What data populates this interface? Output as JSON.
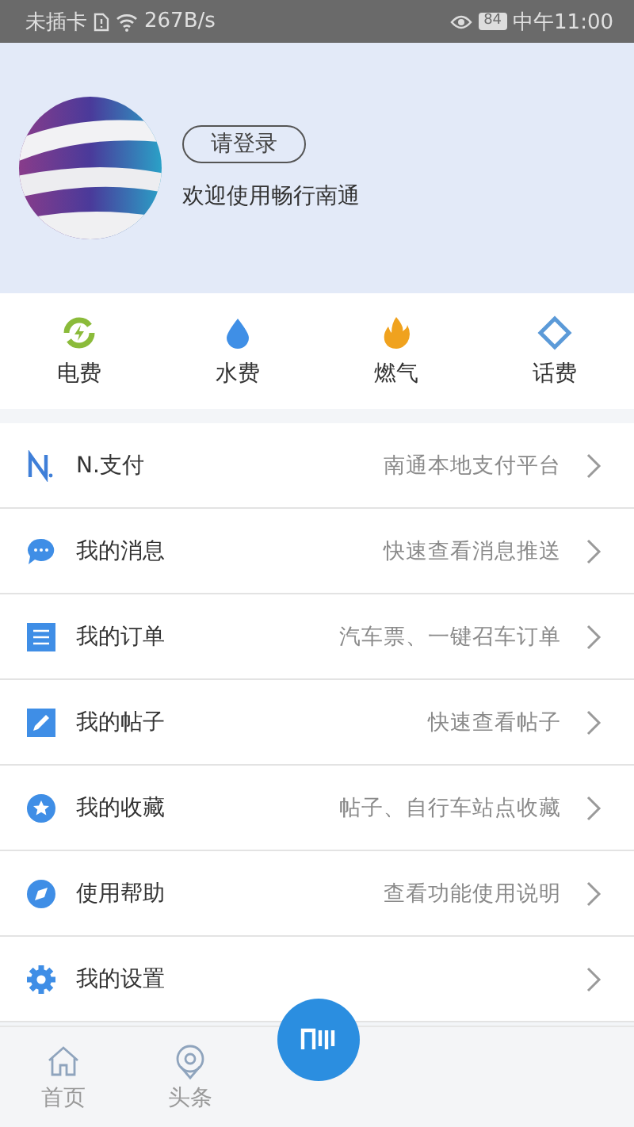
{
  "status_bar": {
    "carrier": "未插卡",
    "speed": "267B/s",
    "battery": "84",
    "time": "中午11:00"
  },
  "profile": {
    "login_button": "请登录",
    "welcome": "欢迎使用畅行南通"
  },
  "shortcuts": [
    {
      "kind": "power",
      "label": "电费"
    },
    {
      "kind": "water",
      "label": "水费"
    },
    {
      "kind": "gas",
      "label": "燃气"
    },
    {
      "kind": "phone",
      "label": "话费"
    }
  ],
  "menu": [
    {
      "kind": "npay",
      "title": "N.支付",
      "hint": "南通本地支付平台"
    },
    {
      "kind": "message",
      "title": "我的消息",
      "hint": "快速查看消息推送"
    },
    {
      "kind": "order",
      "title": "我的订单",
      "hint": "汽车票、一键召车订单"
    },
    {
      "kind": "post",
      "title": "我的帖子",
      "hint": "快速查看帖子"
    },
    {
      "kind": "favorite",
      "title": "我的收藏",
      "hint": "帖子、自行车站点收藏"
    },
    {
      "kind": "help",
      "title": "使用帮助",
      "hint": "查看功能使用说明"
    },
    {
      "kind": "settings",
      "title": "我的设置"
    }
  ],
  "tab_bar": [
    {
      "kind": "home",
      "label": "首页"
    },
    {
      "kind": "news",
      "label": "头条"
    }
  ]
}
